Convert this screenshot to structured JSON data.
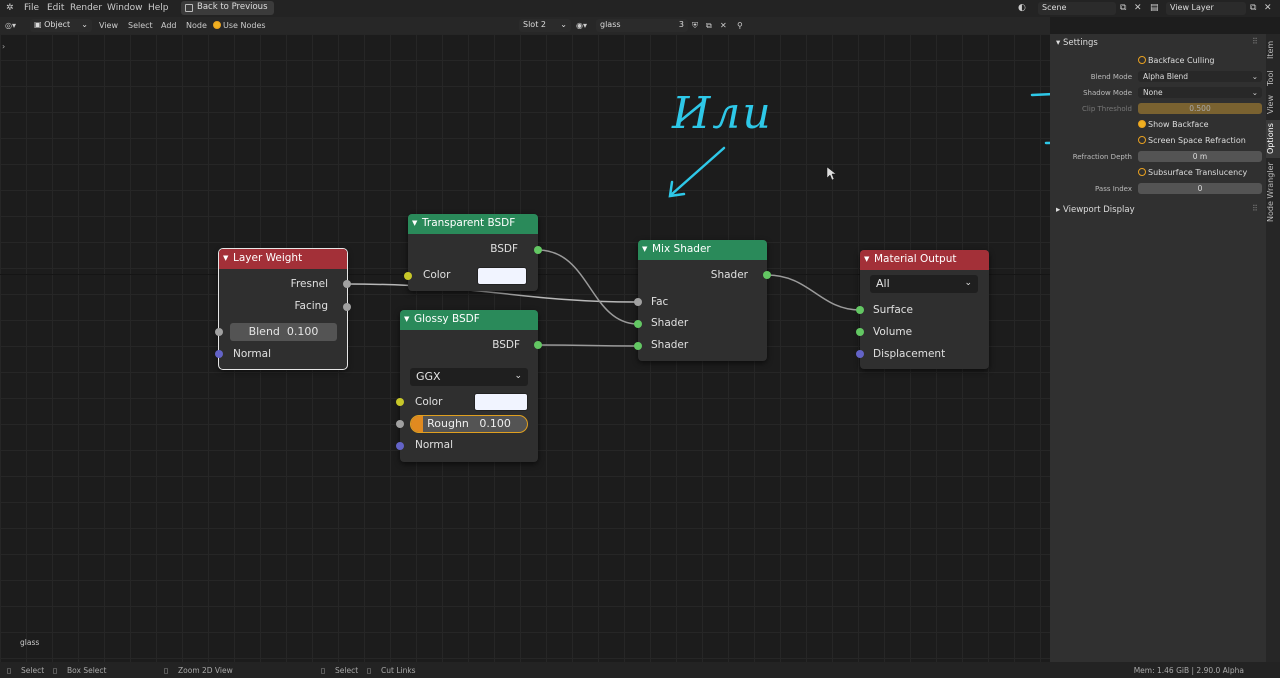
{
  "topbar": {
    "menu": [
      "File",
      "Edit",
      "Render",
      "Window",
      "Help"
    ],
    "back_button": "Back to Previous",
    "scene": "Scene",
    "view_layer": "View Layer"
  },
  "header": {
    "mode": "Object",
    "menus": [
      "View",
      "Select",
      "Add",
      "Node"
    ],
    "use_nodes": "Use Nodes",
    "slot": "Slot 2",
    "material": "glass",
    "users": "3"
  },
  "annotation": {
    "handwritten": "Или"
  },
  "nodes": {
    "layer_weight": {
      "title": "Layer Weight",
      "out1": "Fresnel",
      "out2": "Facing",
      "blend_label": "Blend",
      "blend_value": "0.100",
      "normal": "Normal"
    },
    "transparent": {
      "title": "Transparent BSDF",
      "out": "BSDF",
      "color": "Color"
    },
    "glossy": {
      "title": "Glossy BSDF",
      "out": "BSDF",
      "distribution": "GGX",
      "color": "Color",
      "rough_label": "Roughn",
      "rough_value": "0.100",
      "roughness_fraction": 0.1,
      "normal": "Normal"
    },
    "mix": {
      "title": "Mix Shader",
      "out": "Shader",
      "fac": "Fac",
      "in1": "Shader",
      "in2": "Shader"
    },
    "output": {
      "title": "Material Output",
      "target": "All",
      "surface": "Surface",
      "volume": "Volume",
      "displacement": "Displacement"
    }
  },
  "editor": {
    "material_label": "glass"
  },
  "sidebar": {
    "settings_title": "Settings",
    "backface_culling": "Backface Culling",
    "blend_mode_label": "Blend Mode",
    "blend_mode": "Alpha Blend",
    "shadow_mode_label": "Shadow Mode",
    "shadow_mode": "None",
    "clip_label": "Clip Threshold",
    "clip_value": "0.500",
    "show_backface": "Show Backface",
    "ssr": "Screen Space Refraction",
    "refraction_depth_label": "Refraction Depth",
    "refraction_depth": "0 m",
    "sss": "Subsurface Translucency",
    "pass_index_label": "Pass Index",
    "pass_index": "0",
    "viewport_display": "Viewport Display"
  },
  "tabs": [
    "Item",
    "Tool",
    "View",
    "Options",
    "Node Wrangler"
  ],
  "status": {
    "left": [
      "Select",
      "Box Select",
      "Zoom 2D View",
      "Select",
      "Cut Links"
    ],
    "right": "Mem: 1.46 GiB | 2.90.0 Alpha"
  },
  "colors": {
    "layer_weight_header": "#a33038",
    "shader_header": "#2a8a5a",
    "output_header": "#a33038",
    "annotation": "#2ec8e8"
  }
}
